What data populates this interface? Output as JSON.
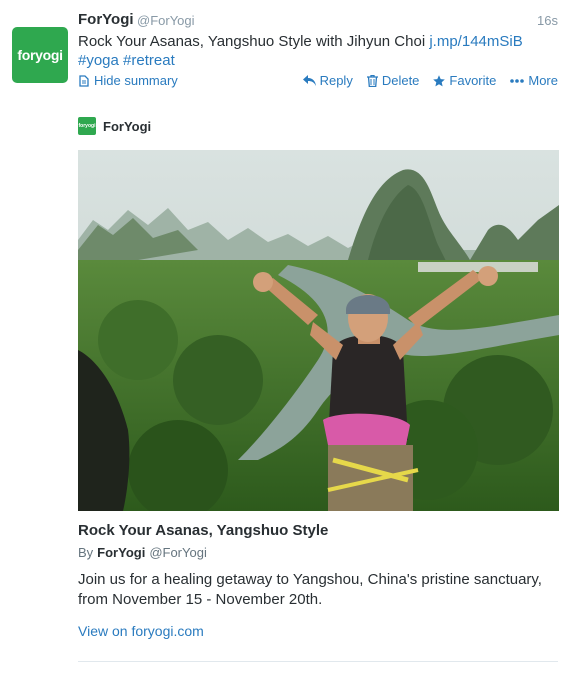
{
  "tweet": {
    "avatar_text": "foryogi",
    "fullname": "ForYogi",
    "screen_name": "@ForYogi",
    "timestamp": "16s",
    "text_line1": "Rock Your Asanas, Yangshuo Style with Jihyun Choi",
    "link": "j.mp/144mSiB",
    "hashtags": [
      "#yoga",
      "#retreat"
    ],
    "hide_summary_label": "Hide summary",
    "actions": {
      "reply": "Reply",
      "delete": "Delete",
      "favorite": "Favorite",
      "more": "More"
    }
  },
  "card": {
    "site_logo_text": "foryogi",
    "site_name": "ForYogi",
    "image_alt": "Climber with arms raised above a green river valley with karst mountains",
    "title": "Rock Your Asanas, Yangshuo Style",
    "by_label": "By",
    "by_name": "ForYogi",
    "by_handle": "@ForYogi",
    "description": "Join us for a healing getaway to Yangshou, China's pristine sanctuary, from November 15 - November 20th.",
    "view_link": "View on foryogi.com"
  },
  "colors": {
    "brand_green": "#2fa84f",
    "link_blue": "#2a7bbf",
    "meta_gray": "#8899a6"
  }
}
